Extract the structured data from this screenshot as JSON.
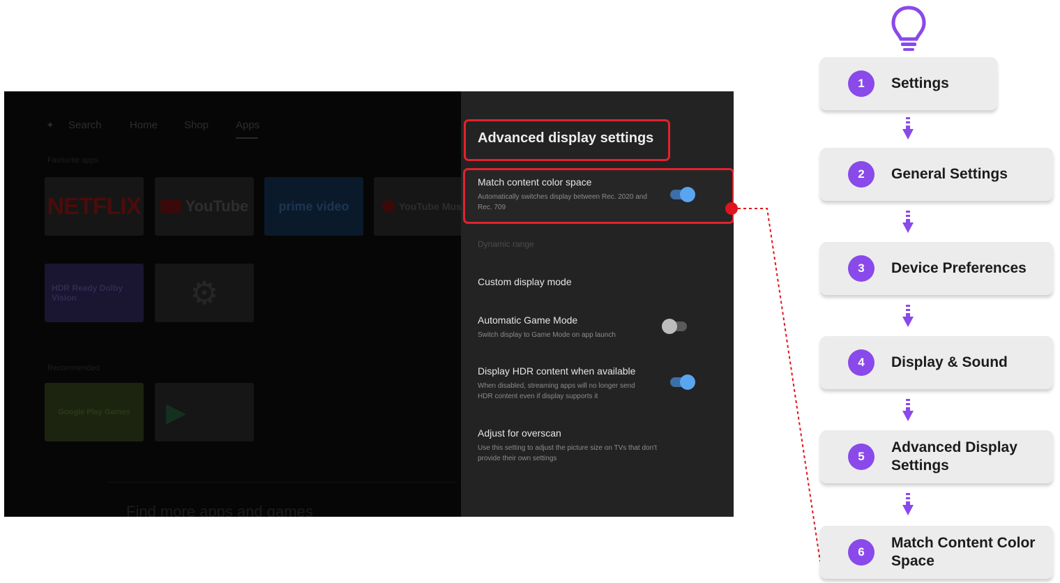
{
  "tv": {
    "nav": [
      "Search",
      "Home",
      "Shop",
      "Apps"
    ],
    "favorites_label": "Favourite apps",
    "apps_row1": [
      "NETFLIX",
      "YouTube",
      "prime video",
      "YouTube Music"
    ],
    "hdr_tile": "HDR Ready Dolby Vision",
    "settings_tile_icon": "gear-icon",
    "recommended_label": "Recommended",
    "green_tile": "Google Play Games",
    "play_tile": "Google Play Store",
    "footer_text": "Find more apps and games"
  },
  "panel": {
    "title": "Advanced display settings",
    "match_title": "Match content color space",
    "match_desc": "Automatically switches display between Rec. 2020 and Rec. 709",
    "match_on": true,
    "section_label": "Dynamic range",
    "custom_mode": "Custom display mode",
    "game_mode_title": "Automatic Game Mode",
    "game_mode_desc": "Switch display to Game Mode on app launch",
    "game_mode_on": false,
    "hdr_title": "Display HDR content when available",
    "hdr_desc": "When disabled, streaming apps will no longer send HDR content even if display supports it",
    "hdr_on": true,
    "overscan_title": "Adjust for overscan",
    "overscan_desc": "Use this setting to adjust the picture size on TVs that don't provide their own settings"
  },
  "steps": [
    {
      "num": "1",
      "label": "Settings"
    },
    {
      "num": "2",
      "label": "General Settings"
    },
    {
      "num": "3",
      "label": "Device Preferences"
    },
    {
      "num": "4",
      "label": "Display & Sound"
    },
    {
      "num": "5",
      "label": "Advanced Display Settings"
    },
    {
      "num": "6",
      "label": "Match Content Color Space"
    }
  ],
  "icons": {
    "bulb": "lightbulb-icon",
    "arrow": "arrow-down-icon"
  },
  "colors": {
    "accent": "#8a49ea",
    "highlight": "#e0232e",
    "toggle_on": "#5aa5f0"
  }
}
